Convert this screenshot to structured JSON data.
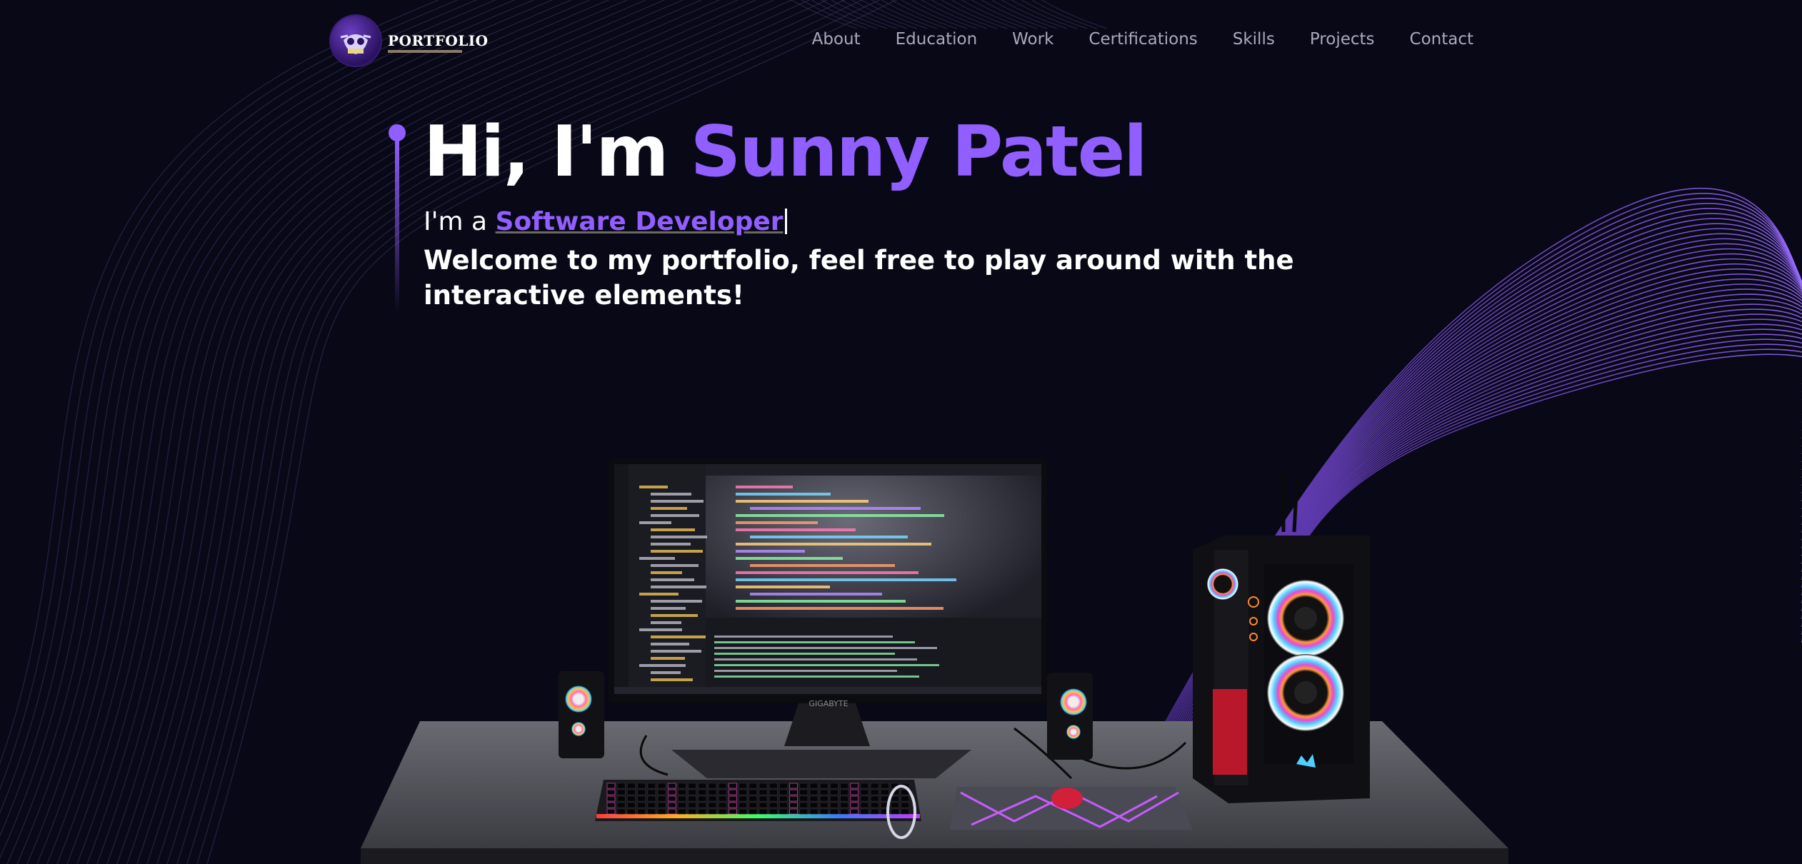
{
  "nav": {
    "brand": "PORTFOLIO",
    "links": [
      "About",
      "Education",
      "Work",
      "Certifications",
      "Skills",
      "Projects",
      "Contact"
    ]
  },
  "hero": {
    "greeting": "Hi, I'm ",
    "name": "Sunny Patel",
    "role_prefix": "I'm a ",
    "role": "Software Developer",
    "welcome": "Welcome to my portfolio, feel free to play around with the interactive elements!"
  },
  "scene": {
    "monitor_brand": "GIGABYTE"
  },
  "colors": {
    "accent": "#915eff",
    "background": "#080816",
    "text": "#ffffff",
    "nav_text": "#a9a9bd"
  }
}
